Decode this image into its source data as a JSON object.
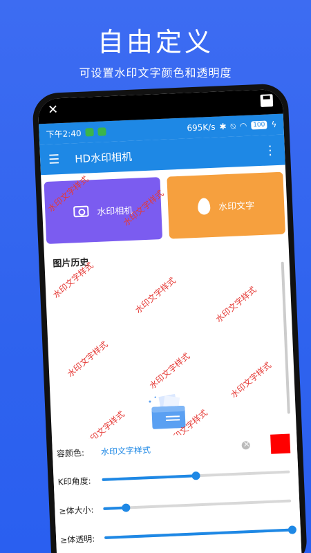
{
  "promo": {
    "title": "自由定义",
    "subtitle": "可设置水印文字颜色和透明度"
  },
  "status_bar": {
    "time": "下午2:40",
    "network_speed": "695K/s",
    "battery": "100"
  },
  "toolbar": {
    "title": "HD水印相机"
  },
  "cards": {
    "camera_label": "水印相机",
    "text_label": "水印文字"
  },
  "history": {
    "title": "图片历史"
  },
  "watermark_text": "水印文字样式",
  "settings": {
    "content_color_label": "容颜色:",
    "content_text_value": "水印文字样式",
    "angle_label": "K印角度:",
    "size_label": "≥体大小:",
    "opacity_label": "≥体透明:",
    "angle_value": 0.5,
    "size_value": 0.12,
    "opacity_value": 1.0,
    "swatch_color": "#ff0000"
  },
  "colors": {
    "accent": "#1e88e5",
    "camera_card": "#7b5cf0",
    "text_card": "#f6a03e",
    "watermark": "#e53935"
  }
}
